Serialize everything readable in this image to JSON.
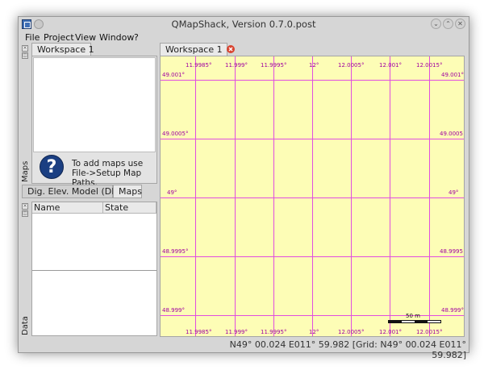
{
  "window": {
    "title": "QMapShack, Version 0.7.0.post",
    "controls": [
      "minimize",
      "maximize",
      "close"
    ]
  },
  "menu": [
    "File",
    "Project",
    "View",
    "Window",
    "?"
  ],
  "left_dock": {
    "maps_workspace_tab": "Workspace 1",
    "maps_side_label": "Maps",
    "help_text": "To add maps use File->Setup Map Paths.",
    "bottom_tabs": [
      "Dig. Elev. Model (DEM)",
      "Maps"
    ],
    "active_bottom_tab": "Maps",
    "data_side_label": "Data",
    "data_columns": [
      "Name",
      "State"
    ]
  },
  "workspace": {
    "tab_label": "Workspace 1",
    "top_longitudes": [
      "11.9985°",
      "11.999°",
      "11.9995°",
      "12°",
      "12.0005°",
      "12.001°",
      "12.0015°"
    ],
    "bottom_longitudes": [
      "11.9985°",
      "11.999°",
      "11.9995°",
      "12°",
      "12.0005°",
      "12.001°",
      "12.0015°"
    ],
    "left_latitudes": [
      "49.001°",
      "49.0005°",
      "49°",
      "48.9995°",
      "48.999°"
    ],
    "right_latitudes": [
      "49.001°",
      "49.0005",
      "49°",
      "48.9995",
      "48.999°"
    ],
    "scale_label": "50 m",
    "colors": {
      "map_bg": "#fdfdb6",
      "grid": "#e04ee0",
      "grid_labels": "#a000a0"
    }
  },
  "status": {
    "coordinates": "N49° 00.024 E011° 59.982 [Grid: N49° 00.024 E011° 59.982]"
  }
}
